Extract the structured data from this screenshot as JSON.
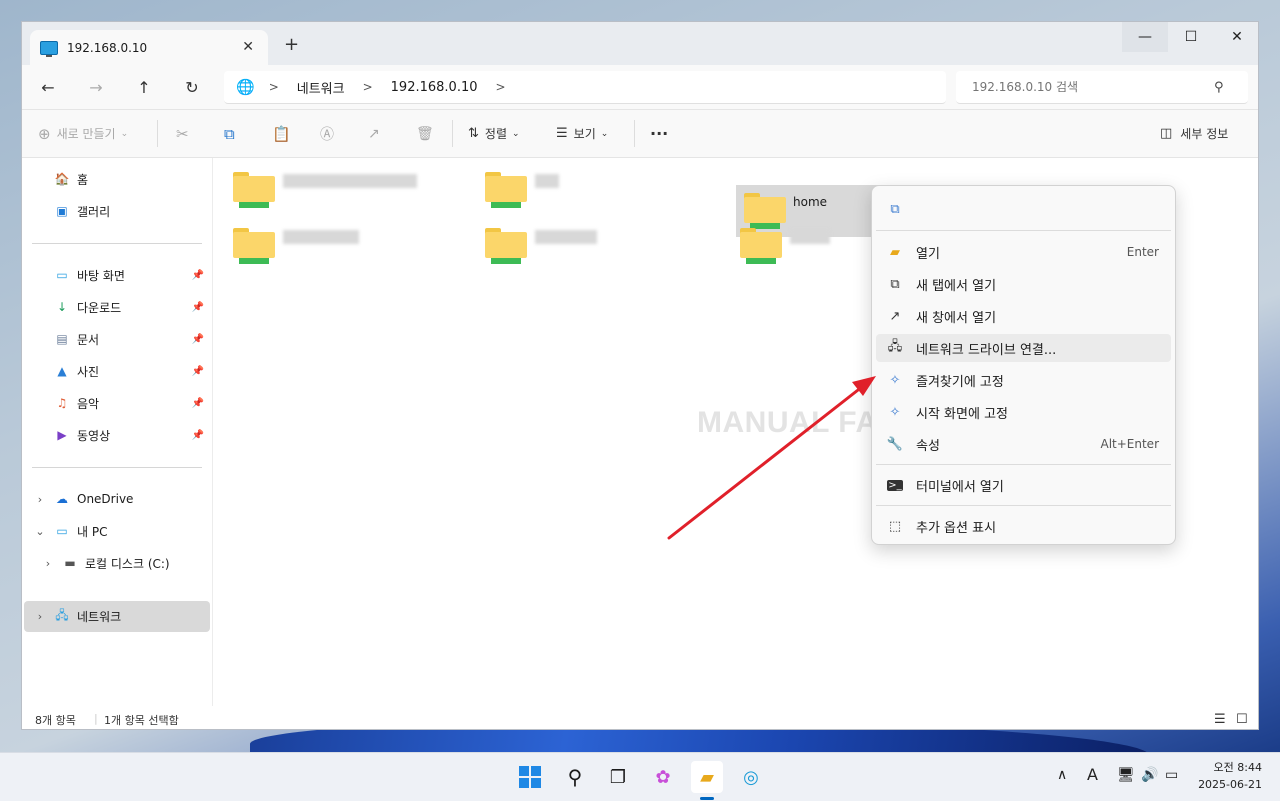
{
  "window": {
    "tab_title": "192.168.0.10",
    "tab_close": "✕",
    "new_tab": "+",
    "min": "—",
    "max": "☐",
    "close": "✕"
  },
  "nav": {
    "back": "←",
    "forward": "→",
    "up": "↑",
    "refresh": "↻",
    "breadcrumb": [
      "네트워크",
      "192.168.0.10"
    ],
    "search_placeholder": "192.168.0.10 검색"
  },
  "toolbar": {
    "new_label": "새로 만들기",
    "sort_label": "정렬",
    "view_label": "보기",
    "more_label": "···",
    "details_label": "세부 정보"
  },
  "sidebar": {
    "home": "홈",
    "gallery": "갤러리",
    "quick": [
      {
        "label": "바탕 화면",
        "icon": "desktop-icon"
      },
      {
        "label": "다운로드",
        "icon": "download-icon"
      },
      {
        "label": "문서",
        "icon": "documents-icon"
      },
      {
        "label": "사진",
        "icon": "pictures-icon"
      },
      {
        "label": "음악",
        "icon": "music-icon"
      },
      {
        "label": "동영상",
        "icon": "videos-icon"
      }
    ],
    "onedrive": "OneDrive",
    "this_pc": "내 PC",
    "local_disk": "로컬 디스크 (C:)",
    "network": "네트워크"
  },
  "content": {
    "selected_folder": "home",
    "watermark": "MANUAL FACTORY"
  },
  "context_menu": {
    "items": [
      {
        "label": "열기",
        "shortcut": "Enter"
      },
      {
        "label": "새 탭에서 열기",
        "shortcut": ""
      },
      {
        "label": "새 창에서 열기",
        "shortcut": ""
      },
      {
        "label": "네트워크 드라이브 연결...",
        "shortcut": ""
      },
      {
        "label": "즐겨찾기에 고정",
        "shortcut": ""
      },
      {
        "label": "시작 화면에 고정",
        "shortcut": ""
      },
      {
        "label": "속성",
        "shortcut": "Alt+Enter"
      },
      {
        "label": "터미널에서 열기",
        "shortcut": ""
      },
      {
        "label": "추가 옵션 표시",
        "shortcut": ""
      }
    ]
  },
  "status": {
    "item_count": "8개 항목",
    "selected": "1개 항목 선택함"
  },
  "taskbar": {
    "time": "오전 8:44",
    "date": "2025-06-21",
    "ime": "A"
  },
  "colors": {
    "accent": "#0067c0",
    "folder": "#fbd66a",
    "annotation_arrow": "#e0202a"
  }
}
